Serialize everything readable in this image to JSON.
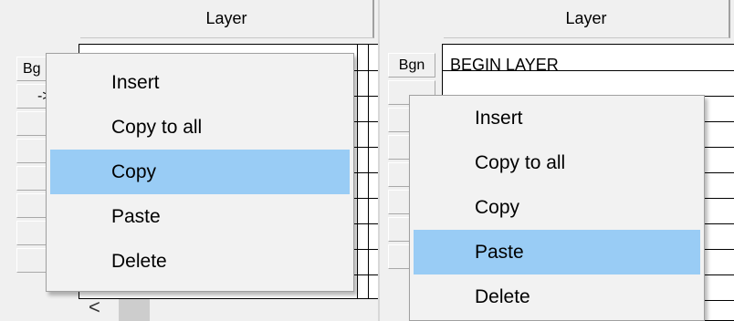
{
  "left": {
    "column_header": "Layer",
    "row_buttons": [
      "Bg",
      "->",
      "",
      "",
      "",
      "",
      ""
    ],
    "context_menu": {
      "items": [
        "Insert",
        "Copy to all",
        "Copy",
        "Paste",
        "Delete"
      ],
      "highlighted": "Copy"
    },
    "scrollbar": {
      "left_arrow": "<"
    }
  },
  "right": {
    "column_header": "Layer",
    "row_buttons": [
      "Bgn",
      "",
      "",
      "",
      "",
      "",
      ""
    ],
    "first_cell": "BEGIN LAYER",
    "context_menu": {
      "items": [
        "Insert",
        "Copy to all",
        "Copy",
        "Paste",
        "Delete"
      ],
      "highlighted": "Paste"
    }
  },
  "colors": {
    "highlight": "#99ccf5",
    "menu_background": "#f2f2f2"
  }
}
